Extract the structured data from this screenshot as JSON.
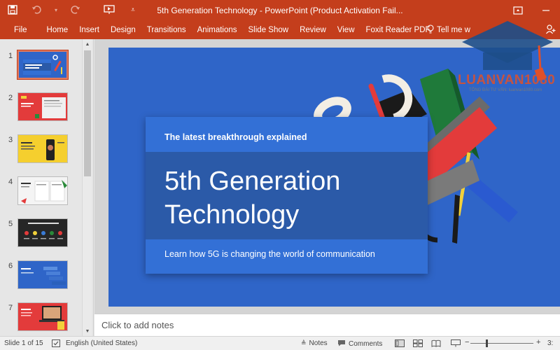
{
  "titlebar": {
    "title": "5th Generation Technology - PowerPoint (Product Activation Fail...",
    "qat_icons": [
      "save-icon",
      "undo-icon",
      "redo-icon",
      "present-from-start-icon",
      "customize-dropdown-icon"
    ],
    "window_icons": [
      "ribbon-display-options-icon",
      "minimize-icon"
    ]
  },
  "ribbon": {
    "tabs": [
      "File",
      "Home",
      "Insert",
      "Design",
      "Transitions",
      "Animations",
      "Slide Show",
      "Review",
      "View",
      "Foxit Reader PDF"
    ],
    "tell_me": "Tell me w"
  },
  "slides_panel": {
    "items": [
      {
        "num": "1",
        "selected": true
      },
      {
        "num": "2",
        "selected": false
      },
      {
        "num": "3",
        "selected": false
      },
      {
        "num": "4",
        "selected": false
      },
      {
        "num": "5",
        "selected": false
      },
      {
        "num": "6",
        "selected": false
      },
      {
        "num": "7",
        "selected": false
      }
    ]
  },
  "slide": {
    "eyebrow": "The latest breakthrough explained",
    "title": "5th Generation Technology",
    "subtitle": "Learn how 5G is changing the world of communication",
    "background_color": "#2f65c8"
  },
  "notes": {
    "placeholder": "Click to add notes"
  },
  "statusbar": {
    "slide_of": "Slide 1 of 15",
    "language": "English (United States)",
    "notes_label": "Notes",
    "comments_label": "Comments",
    "zoom_label": "3:"
  },
  "watermark": {
    "brand": "LUANVAN1080",
    "tagline": "TỔNG ĐÀI TƯ VẤN: luanvan1080.com"
  },
  "colors": {
    "accent": "#c43e1c",
    "slide_blue": "#2f65c8"
  }
}
